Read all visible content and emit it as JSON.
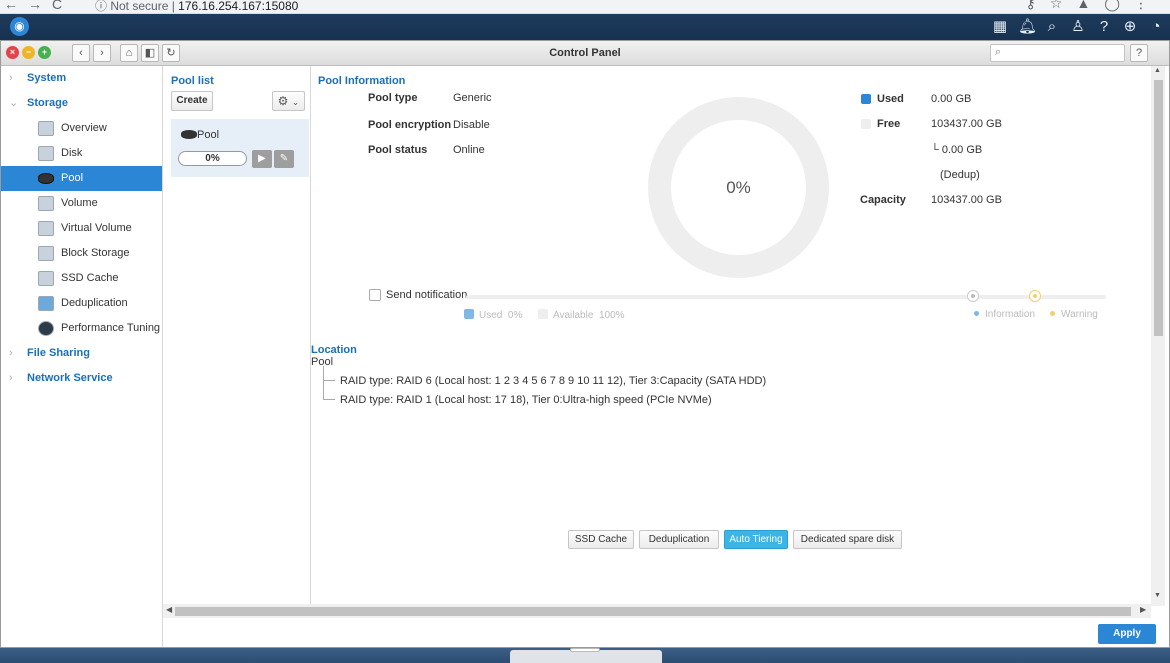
{
  "browser": {
    "security_label": "Not secure",
    "url": "176.16.254.167:15080"
  },
  "window": {
    "title": "Control Panel",
    "search_placeholder": ""
  },
  "sidebar": {
    "categories": {
      "system": "System",
      "storage": "Storage",
      "file_sharing": "File Sharing",
      "network_service": "Network Service"
    },
    "storage_items": [
      {
        "label": "Overview",
        "icon": "overview-icon"
      },
      {
        "label": "Disk",
        "icon": "disk-icon"
      },
      {
        "label": "Pool",
        "icon": "pool-icon",
        "active": true
      },
      {
        "label": "Volume",
        "icon": "volume-icon"
      },
      {
        "label": "Virtual Volume",
        "icon": "virtual-volume-icon"
      },
      {
        "label": "Block Storage",
        "icon": "block-storage-icon"
      },
      {
        "label": "SSD Cache",
        "icon": "ssd-cache-icon"
      },
      {
        "label": "Deduplication",
        "icon": "deduplication-icon"
      },
      {
        "label": "Performance Tuning",
        "icon": "performance-tuning-icon"
      }
    ]
  },
  "pool_list": {
    "title": "Pool list",
    "create_label": "Create",
    "pools": [
      {
        "name": "Pool",
        "usage": "0%"
      }
    ]
  },
  "pool_info": {
    "title": "Pool Information",
    "rows": [
      {
        "label": "Pool type",
        "value": "Generic"
      },
      {
        "label": "Pool encryption",
        "value": "Disable"
      },
      {
        "label": "Pool status",
        "value": "Online"
      }
    ],
    "donut_center": "0%",
    "used_fraction": 0,
    "legend": {
      "used_label": "Used",
      "used_value": "0.00 GB",
      "free_label": "Free",
      "free_value": "103437.00 GB",
      "dedup_value": "└ 0.00 GB",
      "dedup_label": "(Dedup)",
      "capacity_label": "Capacity",
      "capacity_value": "103437.00 GB"
    },
    "colors": {
      "used": "#2b86d6",
      "free": "#eeeeee",
      "information": "#7fb8e6",
      "warning": "#f4cf6b"
    }
  },
  "notification": {
    "checkbox_label": "Send notification",
    "checked": false,
    "used_label": "Used",
    "used_value": "0%",
    "available_label": "Available",
    "available_value": "100%",
    "information_label": "Information",
    "warning_label": "Warning"
  },
  "location": {
    "title": "Location",
    "root": "Pool",
    "items": [
      "RAID type: RAID 6 (Local host: 1 2 3 4 5 6 7 8 9 10 11 12), Tier 3:Capacity (SATA HDD)",
      "RAID type: RAID 1 (Local host: 17 18), Tier 0:Ultra-high speed (PCIe NVMe)"
    ]
  },
  "features": {
    "ssd_cache": "SSD Cache",
    "deduplication": "Deduplication",
    "auto_tiering": "Auto Tiering",
    "dedicated_spare": "Dedicated spare disk"
  },
  "footer": {
    "apply_label": "Apply"
  }
}
